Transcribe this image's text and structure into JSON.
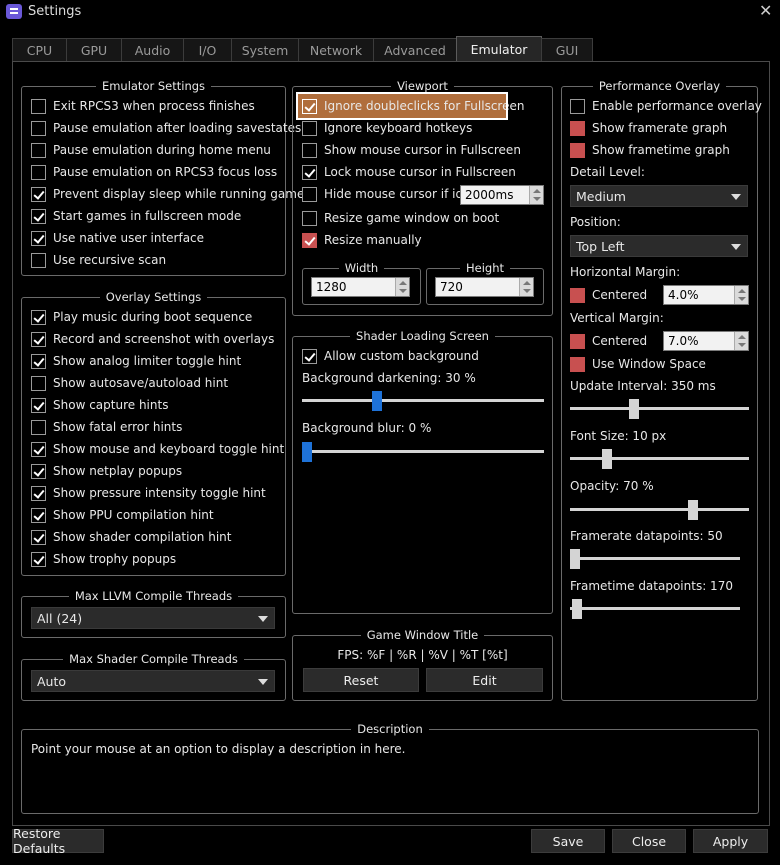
{
  "window": {
    "title": "Settings"
  },
  "tabs": [
    "CPU",
    "GPU",
    "Audio",
    "I/O",
    "System",
    "Network",
    "Advanced",
    "Emulator",
    "GUI"
  ],
  "active_tab": "Emulator",
  "emulator_settings": {
    "title": "Emulator Settings",
    "items": [
      {
        "label": "Exit RPCS3 when process finishes",
        "checked": false
      },
      {
        "label": "Pause emulation after loading savestates",
        "checked": false
      },
      {
        "label": "Pause emulation during home menu",
        "checked": false
      },
      {
        "label": "Pause emulation on RPCS3 focus loss",
        "checked": false
      },
      {
        "label": "Prevent display sleep while running games",
        "checked": true
      },
      {
        "label": "Start games in fullscreen mode",
        "checked": true
      },
      {
        "label": "Use native user interface",
        "checked": true
      },
      {
        "label": "Use recursive scan",
        "checked": false
      }
    ]
  },
  "overlay_settings": {
    "title": "Overlay Settings",
    "items": [
      {
        "label": "Play music during boot sequence",
        "checked": true
      },
      {
        "label": "Record and screenshot with overlays",
        "checked": true
      },
      {
        "label": "Show analog limiter toggle hint",
        "checked": true
      },
      {
        "label": "Show autosave/autoload hint",
        "checked": false
      },
      {
        "label": "Show capture hints",
        "checked": true
      },
      {
        "label": "Show fatal error hints",
        "checked": false
      },
      {
        "label": "Show mouse and keyboard toggle hint",
        "checked": true
      },
      {
        "label": "Show netplay popups",
        "checked": true
      },
      {
        "label": "Show pressure intensity toggle hint",
        "checked": true
      },
      {
        "label": "Show PPU compilation hint",
        "checked": true
      },
      {
        "label": "Show shader compilation hint",
        "checked": true
      },
      {
        "label": "Show trophy popups",
        "checked": true
      }
    ]
  },
  "llvm_threads": {
    "title": "Max LLVM Compile Threads",
    "value": "All (24)"
  },
  "shader_threads": {
    "title": "Max Shader Compile Threads",
    "value": "Auto"
  },
  "viewport": {
    "title": "Viewport",
    "ignore_doubleclicks": "Ignore doubleclicks for Fullscreen",
    "ignore_hotkeys": "Ignore keyboard hotkeys",
    "show_cursor": "Show mouse cursor in Fullscreen",
    "lock_cursor": "Lock mouse cursor in Fullscreen",
    "hide_cursor": "Hide mouse cursor if idle",
    "hide_cursor_value": "2000ms",
    "resize_boot": "Resize game window on boot",
    "resize_manual": "Resize manually",
    "width_title": "Width",
    "width_value": "1280",
    "height_title": "Height",
    "height_value": "720"
  },
  "shader_loading": {
    "title": "Shader Loading Screen",
    "allow_custom": "Allow custom background",
    "darkening_label": "Background darkening: 30 %",
    "darkening_value": 30,
    "blur_label": "Background blur: 0 %",
    "blur_value": 0
  },
  "game_window_title": {
    "title": "Game Window Title",
    "format": "FPS: %F | %R | %V | %T [%t]",
    "reset": "Reset",
    "edit": "Edit"
  },
  "performance_overlay": {
    "title": "Performance Overlay",
    "enable": "Enable performance overlay",
    "framerate_graph": "Show framerate graph",
    "frametime_graph": "Show frametime graph",
    "detail_level_label": "Detail Level:",
    "detail_level": "Medium",
    "position_label": "Position:",
    "position": "Top Left",
    "h_margin_label": "Horizontal Margin:",
    "h_centered": "Centered",
    "h_margin_value": "4.0%",
    "v_margin_label": "Vertical Margin:",
    "v_centered": "Centered",
    "v_margin_value": "7.0%",
    "window_space": "Use Window Space",
    "update_interval_label": "Update Interval: 350 ms",
    "update_interval": 350,
    "font_size_label": "Font Size: 10 px",
    "font_size": 10,
    "opacity_label": "Opacity: 70 %",
    "opacity": 70,
    "framerate_dp_label": "Framerate datapoints: 50",
    "framerate_dp": 50,
    "frametime_dp_label": "Frametime datapoints: 170",
    "frametime_dp": 170
  },
  "description": {
    "title": "Description",
    "text": "Point your mouse at an option to display a description in here."
  },
  "footer": {
    "restore": "Restore Defaults",
    "save": "Save",
    "close": "Close",
    "apply": "Apply"
  }
}
